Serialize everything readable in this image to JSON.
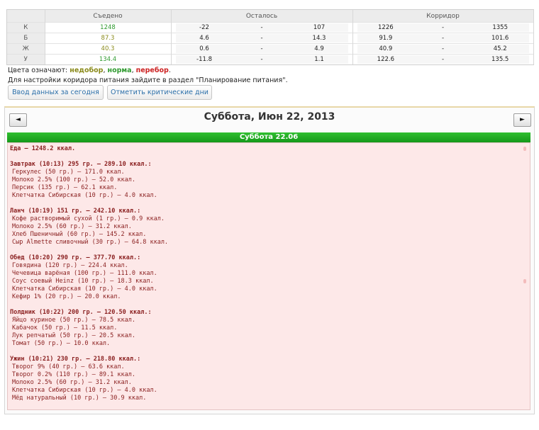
{
  "summary": {
    "headers": [
      "",
      "Съедено",
      "Осталось",
      "Корридор"
    ],
    "rows": [
      {
        "label": "К",
        "eaten": "1248",
        "eaten_color": "#2f9a2f",
        "left": [
          "-22",
          "-",
          "107"
        ],
        "corridor": [
          "1226",
          "-",
          "1355"
        ]
      },
      {
        "label": "Б",
        "eaten": "87.3",
        "eaten_color": "#8a8a1a",
        "left": [
          "4.6",
          "-",
          "14.3"
        ],
        "corridor": [
          "91.9",
          "-",
          "101.6"
        ]
      },
      {
        "label": "Ж",
        "eaten": "40.3",
        "eaten_color": "#8a8a1a",
        "left": [
          "0.6",
          "-",
          "4.9"
        ],
        "corridor": [
          "40.9",
          "-",
          "45.2"
        ]
      },
      {
        "label": "У",
        "eaten": "134.4",
        "eaten_color": "#2f9a2f",
        "left": [
          "-11.8",
          "-",
          "1.1"
        ],
        "corridor": [
          "122.6",
          "-",
          "135.5"
        ]
      }
    ]
  },
  "legend": {
    "prefix": "Цвета означают: ",
    "under": "недобор",
    "under_color": "#8a8a1a",
    "sep1": ", ",
    "norm": "норма",
    "norm_color": "#2f9a2f",
    "sep2": ", ",
    "over": "перебор",
    "over_color": "#cc2222",
    "suffix": "."
  },
  "hint": "Для настройки коридора питания зайдите в раздел \"Планирование питания\".",
  "buttons": {
    "today": "Ввод данных за сегодня",
    "critical": "Отметить критические дни"
  },
  "nav": {
    "prev": "◄",
    "next": "►",
    "date": "Суббота, Июн 22, 2013"
  },
  "day": {
    "bar": "Суббота 22.06",
    "total": "Еда — 1248.2 ккал.",
    "meals": [
      {
        "head": "Завтрак (10:13) 295 гр. — 289.10 ккал.:",
        "items": [
          "Геркулес (50 гр.) — 171.0 ккал.",
          "Молоко 2.5% (100 гр.) — 52.0 ккал.",
          "Персик (135 гр.) — 62.1 ккал.",
          "Клетчатка Сибирская (10 гр.) — 4.0 ккал."
        ]
      },
      {
        "head": "Ланч (10:19) 151 гр. — 242.10 ккал.:",
        "items": [
          "Кофе растворимый сухой (1 гр.) — 0.9 ккал.",
          "Молоко 2.5% (60 гр.) — 31.2 ккал.",
          "Хлеб Пшеничный (60 гр.) — 145.2 ккал.",
          "Сыр Almette сливочный (30 гр.) — 64.8 ккал."
        ]
      },
      {
        "head": "Обед (10:20) 290 гр. — 377.70 ккал.:",
        "items": [
          "Говядина (120 гр.) — 224.4 ккал.",
          "Чечевица варёная (100 гр.) — 111.0 ккал.",
          "Соус соевый Heinz (10 гр.) — 18.3 ккал.",
          "Клетчатка Сибирская (10 гр.) — 4.0 ккал.",
          "Кефир 1% (20 гр.) — 20.0 ккал."
        ]
      },
      {
        "head": "Полдник (10:22) 200 гр. — 120.50 ккал.:",
        "items": [
          "Яйцо куриное (50 гр.) — 78.5 ккал.",
          "Кабачок (50 гр.) — 11.5 ккал.",
          "Лук репчатый (50 гр.) — 20.5 ккал.",
          "Томат (50 гр.) — 10.0 ккал."
        ]
      },
      {
        "head": "Ужин (10:21) 230 гр. — 218.80 ккал.:",
        "items": [
          "Творог 9% (40 гр.) — 63.6 ккал.",
          "Творог 0.2% (110 гр.) — 89.1 ккал.",
          "Молоко 2.5% (60 гр.) — 31.2 ккал.",
          "Клетчатка Сибирская (10 гр.) — 4.0 ккал.",
          "Мёд натуральный (10 гр.) — 30.9 ккал."
        ]
      }
    ]
  }
}
